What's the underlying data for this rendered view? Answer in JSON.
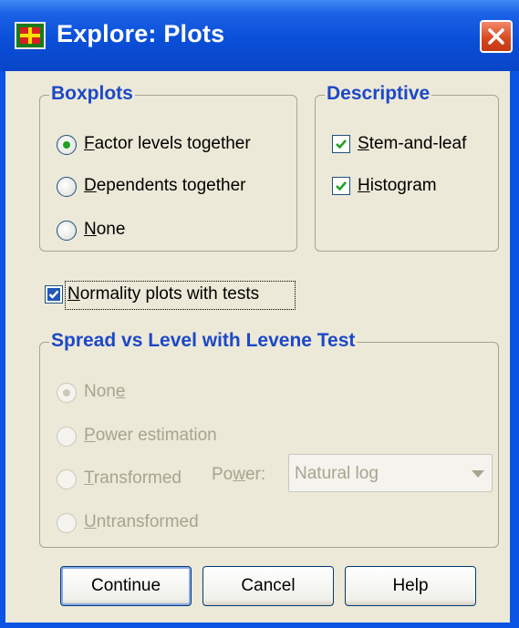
{
  "window": {
    "title": "Explore: Plots"
  },
  "boxplots": {
    "legend": "Boxplots",
    "options": [
      {
        "label": "Factor levels together",
        "selected": true
      },
      {
        "label": "Dependents together",
        "selected": false
      },
      {
        "label": "None",
        "selected": false
      }
    ]
  },
  "descriptive": {
    "legend": "Descriptive",
    "options": [
      {
        "label": "Stem-and-leaf",
        "checked": true
      },
      {
        "label": "Histogram",
        "checked": true
      }
    ]
  },
  "normality": {
    "label": "Normality plots with tests",
    "checked": true
  },
  "spread": {
    "legend": "Spread vs Level with Levene Test",
    "options": [
      {
        "label": "None",
        "selected": true
      },
      {
        "label": "Power estimation",
        "selected": false
      },
      {
        "label": "Transformed",
        "selected": false
      },
      {
        "label": "Untransformed",
        "selected": false
      }
    ],
    "power_label": "Power:",
    "power_value": "Natural log"
  },
  "buttons": {
    "continue": "Continue",
    "cancel": "Cancel",
    "help": "Help"
  },
  "colors": {
    "titlebar": "#0a4fd8",
    "legend": "#1d48c7",
    "dialog_bg": "#ece9d8",
    "disabled_text": "#a7a48e"
  }
}
